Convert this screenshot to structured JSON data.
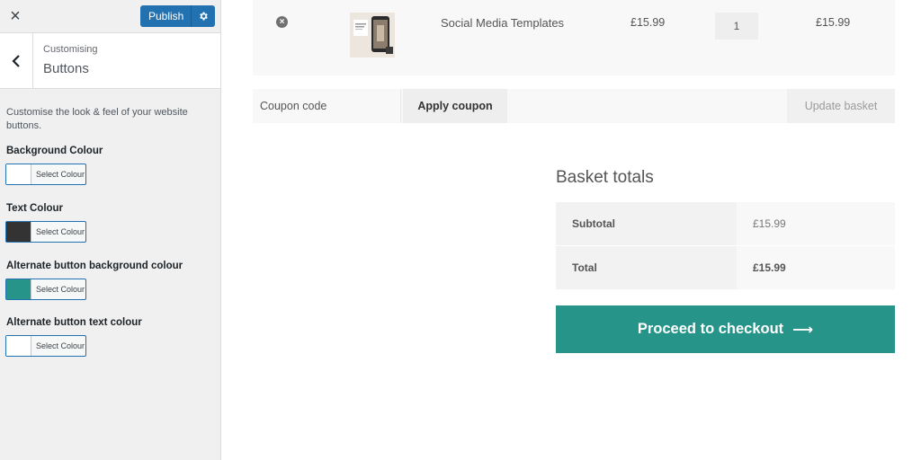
{
  "customizer": {
    "publish_label": "Publish",
    "breadcrumb": "Customising",
    "section_title": "Buttons",
    "description": "Customise the look & feel of your website buttons.",
    "controls": [
      {
        "label": "Background Colour",
        "button_text": "Select Colour",
        "swatch": "#ffffff"
      },
      {
        "label": "Text Colour",
        "button_text": "Select Colour",
        "swatch": "#333333"
      },
      {
        "label": "Alternate button background colour",
        "button_text": "Select Colour",
        "swatch": "#269488"
      },
      {
        "label": "Alternate button text colour",
        "button_text": "Select Colour",
        "swatch": "#ffffff"
      }
    ]
  },
  "cart": {
    "item": {
      "name": "Social Media Templates",
      "price": "£15.99",
      "quantity": "1",
      "subtotal": "£15.99"
    },
    "coupon_placeholder": "Coupon code",
    "apply_coupon_label": "Apply coupon",
    "update_basket_label": "Update basket"
  },
  "totals": {
    "title": "Basket totals",
    "subtotal_label": "Subtotal",
    "subtotal_value": "£15.99",
    "total_label": "Total",
    "total_value": "£15.99"
  },
  "checkout_label": "Proceed to checkout",
  "colors": {
    "accent": "#269488",
    "wp_blue": "#2271b1"
  }
}
